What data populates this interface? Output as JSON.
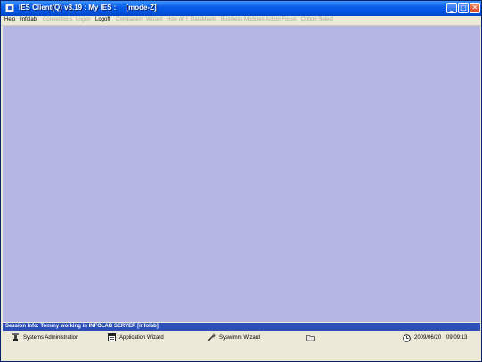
{
  "window": {
    "title": "IES Client(Q) v8.19 : My IES :     [mode-Z]",
    "min_glyph": "_",
    "max_glyph": "□",
    "close_glyph": "✕"
  },
  "menu": {
    "items": [
      {
        "label": "Help",
        "enabled": true
      },
      {
        "label": "Infolab",
        "enabled": true
      },
      {
        "label": "Connections",
        "enabled": false
      },
      {
        "label": "Logon",
        "enabled": false
      },
      {
        "label": "Logoff",
        "enabled": true
      },
      {
        "label": "Companion",
        "enabled": false
      },
      {
        "label": "Wizard",
        "enabled": false
      },
      {
        "label": "How do I",
        "enabled": false
      },
      {
        "label": "DataMeets",
        "enabled": false
      },
      {
        "label": "Business Modules",
        "enabled": false
      },
      {
        "label": "Action Focus",
        "enabled": false
      },
      {
        "label": "Option Select",
        "enabled": false
      }
    ]
  },
  "session": {
    "info": "Session Info: Tommy working in INFOLAB SERVER  [infolab]"
  },
  "taskbar": {
    "items": [
      {
        "label": "Systems Administration",
        "icon": "wrench-icon"
      },
      {
        "label": "Application Wizard",
        "icon": "window-icon"
      },
      {
        "label": "Syswimm Wizard",
        "icon": "wand-icon"
      },
      {
        "label": "",
        "icon": "folder-icon"
      }
    ],
    "date": "2009/06/20",
    "time": "09:09:13",
    "clock_icon": "clock-icon"
  },
  "colors": {
    "titlebar": "#0054e3",
    "workspace": "#b5b5e3",
    "session_bar": "#2c4fb7",
    "chrome": "#ece9d8"
  }
}
